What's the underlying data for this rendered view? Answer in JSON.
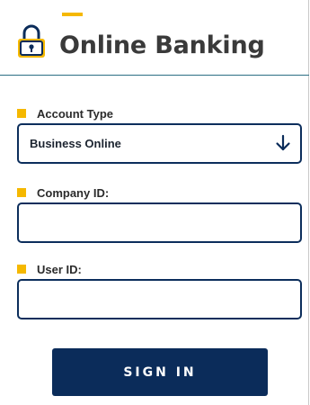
{
  "header": {
    "title": "Online Banking",
    "icon": "lock-icon"
  },
  "form": {
    "account_type": {
      "label": "Account Type",
      "selected": "Business Online",
      "icon": "arrow-down-icon"
    },
    "company_id": {
      "label": "Company ID:",
      "value": "",
      "placeholder": ""
    },
    "user_id": {
      "label": "User ID:",
      "value": "",
      "placeholder": ""
    },
    "submit_label": "SIGN IN"
  },
  "colors": {
    "accent": "#f5b800",
    "brand_navy": "#0b2c5a",
    "divider": "#2b6f84",
    "title_text": "#3a3a3a"
  }
}
